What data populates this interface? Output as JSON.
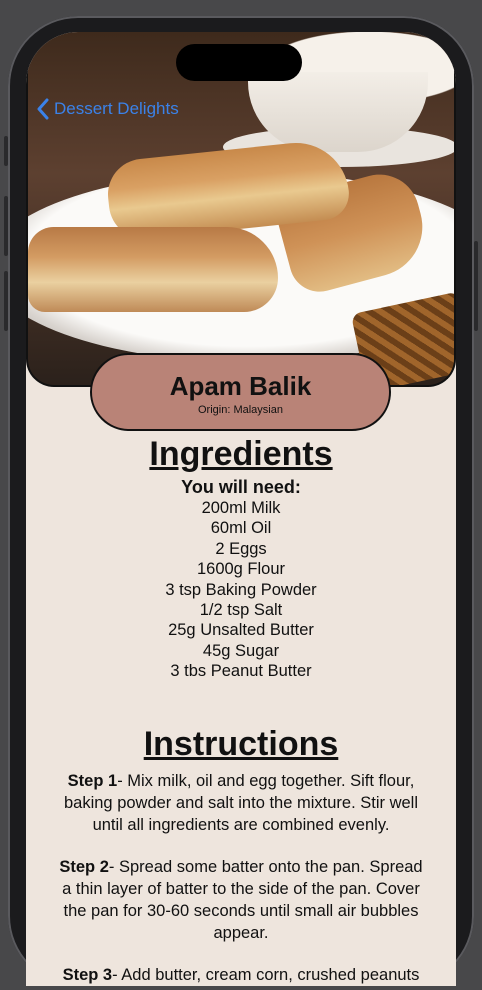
{
  "nav": {
    "back_label": "Dessert Delights"
  },
  "recipe": {
    "name": "Apam Balik",
    "origin": "Origin: Malaysian"
  },
  "ingredients": {
    "heading": "Ingredients",
    "subheading": "You will need:",
    "items": [
      "200ml Milk",
      "60ml Oil",
      "2 Eggs",
      "1600g Flour",
      "3 tsp Baking Powder",
      "1/2 tsp Salt",
      "25g Unsalted Butter",
      "45g Sugar",
      "3 tbs Peanut Butter"
    ]
  },
  "instructions": {
    "heading": "Instructions",
    "steps": [
      {
        "label": "Step 1",
        "text": "- Mix milk, oil and egg together. Sift flour, baking powder and salt into the mixture. Stir well until all ingredients are combined evenly."
      },
      {
        "label": "Step 2",
        "text": "- Spread some batter onto the pan. Spread a thin layer of batter to the side of the pan. Cover the pan for 30-60 seconds until small air bubbles appear."
      },
      {
        "label": "Step 3",
        "text": "- Add butter, cream corn, crushed peanuts and sugar onto the pancake."
      }
    ]
  },
  "colors": {
    "accent": "#3b82e8",
    "pill": "#b98377",
    "background": "#eee5dd"
  }
}
